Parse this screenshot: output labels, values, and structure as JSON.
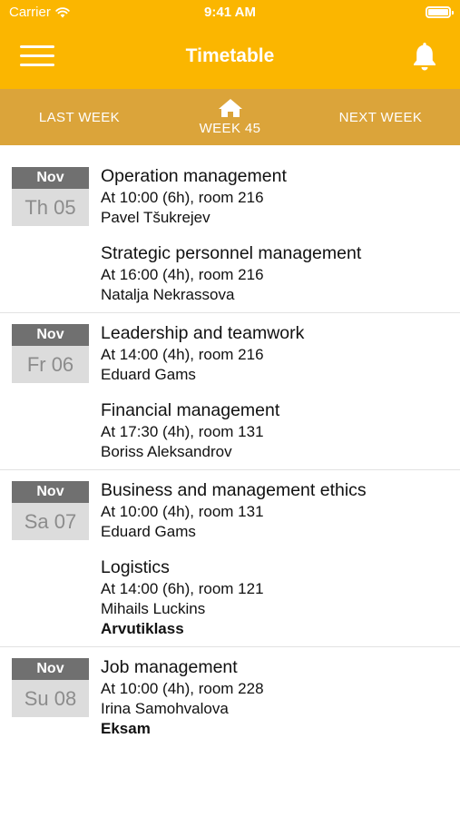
{
  "status_bar": {
    "carrier": "Carrier",
    "time": "9:41 AM",
    "wifi_icon": "wifi-icon",
    "battery_icon": "battery-icon"
  },
  "nav": {
    "title": "Timetable",
    "menu_icon": "hamburger-menu-icon",
    "bell_icon": "bell-icon"
  },
  "week_nav": {
    "prev_label": "LAST WEEK",
    "current_label": "WEEK 45",
    "next_label": "NEXT WEEK",
    "home_icon": "home-icon"
  },
  "colors": {
    "header": "#fbb600",
    "week_bar": "#dba43a",
    "month_box": "#707070",
    "day_box": "#dcdcdc"
  },
  "days": [
    {
      "month": "Nov",
      "day": "Th 05",
      "lessons": [
        {
          "name": "Operation management",
          "time_room": "At 10:00 (6h),  room 216",
          "teacher": "Pavel Tšukrejev",
          "tag": ""
        },
        {
          "name": "Strategic personnel management",
          "time_room": "At 16:00 (4h),  room 216",
          "teacher": "Natalja Nekrassova",
          "tag": ""
        }
      ]
    },
    {
      "month": "Nov",
      "day": "Fr 06",
      "lessons": [
        {
          "name": "Leadership and teamwork",
          "time_room": "At 14:00 (4h),  room 216",
          "teacher": "Eduard Gams",
          "tag": ""
        },
        {
          "name": "Financial management",
          "time_room": "At 17:30 (4h),  room 131",
          "teacher": "Boriss Aleksandrov",
          "tag": ""
        }
      ]
    },
    {
      "month": "Nov",
      "day": "Sa 07",
      "lessons": [
        {
          "name": "Business and management ethics",
          "time_room": "At 10:00 (4h),  room 131",
          "teacher": "Eduard Gams",
          "tag": ""
        },
        {
          "name": "Logistics",
          "time_room": "At 14:00 (6h),  room 121",
          "teacher": "Mihails Luckins",
          "tag": "Arvutiklass"
        }
      ]
    },
    {
      "month": "Nov",
      "day": "Su 08",
      "lessons": [
        {
          "name": "Job management",
          "time_room": "At 10:00 (4h),  room 228",
          "teacher": "Irina Samohvalova",
          "tag": "Eksam"
        }
      ]
    }
  ]
}
